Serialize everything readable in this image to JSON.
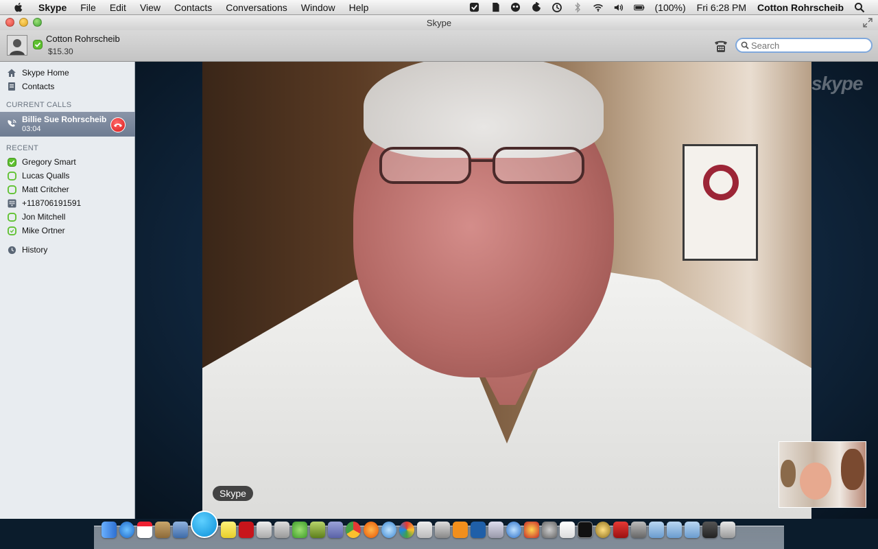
{
  "menubar": {
    "app_name": "Skype",
    "items": [
      "File",
      "Edit",
      "View",
      "Contacts",
      "Conversations",
      "Window",
      "Help"
    ],
    "battery": "(100%)",
    "clock": "Fri 6:28 PM",
    "user": "Cotton Rohrscheib"
  },
  "window": {
    "title": "Skype"
  },
  "profile": {
    "name": "Cotton Rohrscheib",
    "credit": "$15.30",
    "presence_color": "#5fc130"
  },
  "search": {
    "placeholder": "Search"
  },
  "sidebar": {
    "skype_home": "Skype Home",
    "contacts": "Contacts",
    "current_calls_label": "CURRENT CALLS",
    "current_call": {
      "name": "Billie Sue Rohrscheib",
      "duration": "03:04"
    },
    "recent_label": "RECENT",
    "recent": [
      {
        "name": "Gregory Smart",
        "icon": "presence-online-icon"
      },
      {
        "name": "Lucas Qualls",
        "icon": "presence-offline-icon"
      },
      {
        "name": "Matt Critcher",
        "icon": "presence-offline-icon"
      },
      {
        "name": "+118706191591",
        "icon": "phone-number-icon"
      },
      {
        "name": "Jon Mitchell",
        "icon": "presence-offline-icon"
      },
      {
        "name": "Mike Ortner",
        "icon": "presence-away-icon"
      }
    ],
    "history": "History"
  },
  "video": {
    "brand": "skype"
  },
  "dock": {
    "tooltip": "Skype"
  },
  "colors": {
    "accent": "#7fa8dc",
    "hangup": "#d91818",
    "online": "#5fc130"
  }
}
